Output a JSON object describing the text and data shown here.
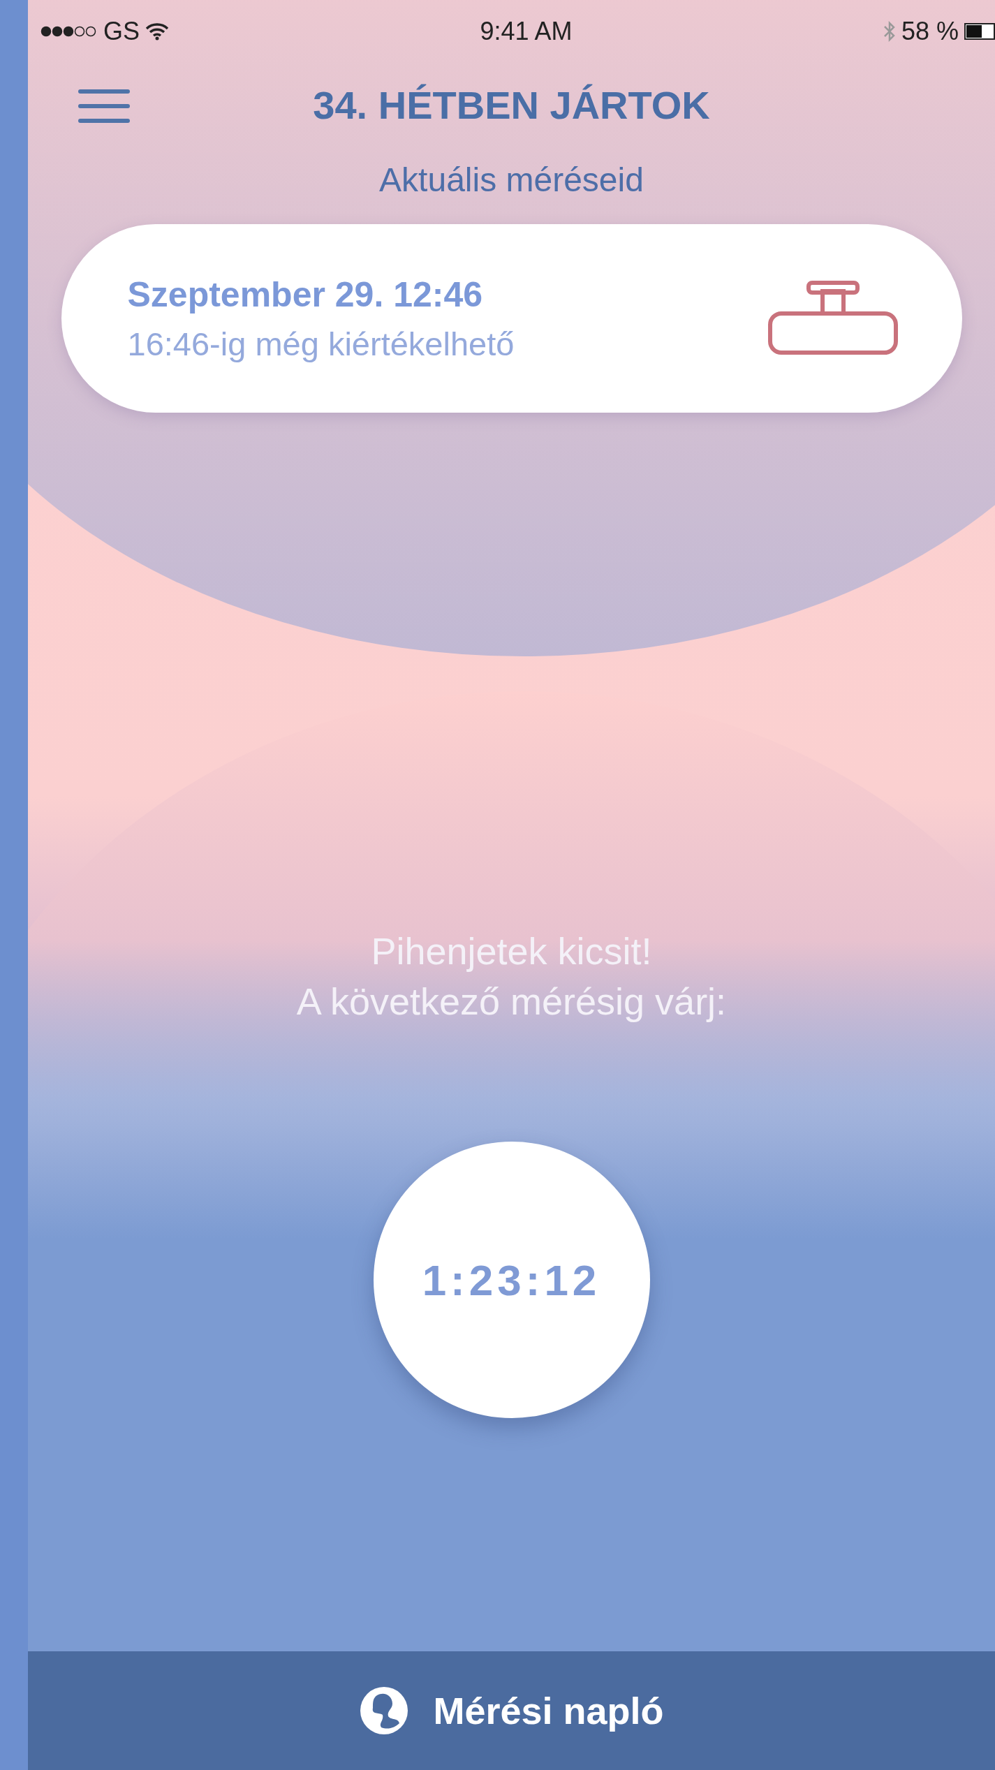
{
  "status_bar": {
    "carrier": "GS",
    "time": "9:41 AM",
    "battery": "58 %"
  },
  "header": {
    "title": "34. HÉTBEN JÁRTOK"
  },
  "section_title": "Aktuális méréseid",
  "measurement": {
    "date": "Szeptember 29. 12:46",
    "note": "16:46-ig még kiértékelhető"
  },
  "message": [
    "Pihenjetek kicsit!",
    "A következő mérésig várj:"
  ],
  "timer": "1:23:12",
  "bottom_bar": {
    "label": "Mérési napló"
  }
}
